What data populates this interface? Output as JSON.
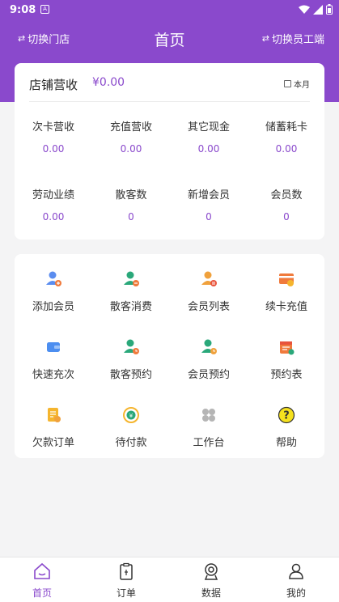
{
  "status_bar": {
    "time": "9:08",
    "notification_glyph": "A"
  },
  "header": {
    "switch_store": "切换门店",
    "title": "首页",
    "switch_staff": "切换员工端"
  },
  "store_revenue": {
    "title": "店铺营收",
    "amount": "¥0.00",
    "period": "本月",
    "stats": [
      {
        "label": "次卡营收",
        "value": "0.00"
      },
      {
        "label": "充值营收",
        "value": "0.00"
      },
      {
        "label": "其它现金",
        "value": "0.00"
      },
      {
        "label": "储蓄耗卡",
        "value": "0.00"
      },
      {
        "label": "劳动业绩",
        "value": "0.00"
      },
      {
        "label": "散客数",
        "value": "0"
      },
      {
        "label": "新增会员",
        "value": "0"
      },
      {
        "label": "会员数",
        "value": "0"
      }
    ]
  },
  "functions": [
    {
      "label": "添加会员",
      "icon": "add-member-icon"
    },
    {
      "label": "散客消费",
      "icon": "walkin-consume-icon"
    },
    {
      "label": "会员列表",
      "icon": "member-list-icon"
    },
    {
      "label": "续卡充值",
      "icon": "card-recharge-icon"
    },
    {
      "label": "快速充次",
      "icon": "quick-recharge-icon"
    },
    {
      "label": "散客预约",
      "icon": "walkin-booking-icon"
    },
    {
      "label": "会员预约",
      "icon": "member-booking-icon"
    },
    {
      "label": "预约表",
      "icon": "booking-calendar-icon"
    },
    {
      "label": "欠款订单",
      "icon": "debt-order-icon"
    },
    {
      "label": "待付款",
      "icon": "pending-payment-icon"
    },
    {
      "label": "工作台",
      "icon": "workbench-icon"
    },
    {
      "label": "帮助",
      "icon": "help-icon"
    }
  ],
  "tabbar": [
    {
      "label": "首页",
      "icon": "home-icon",
      "active": true
    },
    {
      "label": "订单",
      "icon": "order-icon",
      "active": false
    },
    {
      "label": "数据",
      "icon": "data-icon",
      "active": false
    },
    {
      "label": "我的",
      "icon": "profile-icon",
      "active": false
    }
  ],
  "colors": {
    "primary": "#8a49cc",
    "background": "#f4f4f5",
    "card": "#ffffff"
  }
}
